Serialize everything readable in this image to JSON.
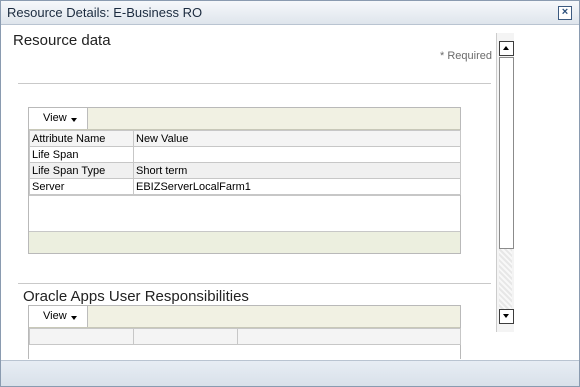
{
  "window": {
    "title": "Resource Details: E-Business RO",
    "close_icon": "close-icon"
  },
  "resource_data": {
    "heading": "Resource data",
    "required_text": "* Required",
    "toolbar": {
      "view_label": "View"
    },
    "columns": [
      "Attribute Name",
      "New Value"
    ],
    "rows": [
      {
        "name": "Life Span",
        "value": ""
      },
      {
        "name": "Life Span Type",
        "value": "Short term"
      },
      {
        "name": "Server",
        "value": "EBIZServerLocalFarm1"
      }
    ]
  },
  "responsibilities": {
    "heading": "Oracle Apps User Responsibilities",
    "toolbar": {
      "view_label": "View"
    }
  },
  "colors": {
    "titlebar": "#dfe5ec",
    "border": "#8a9bb0",
    "table_footer": "#ecefdf"
  }
}
